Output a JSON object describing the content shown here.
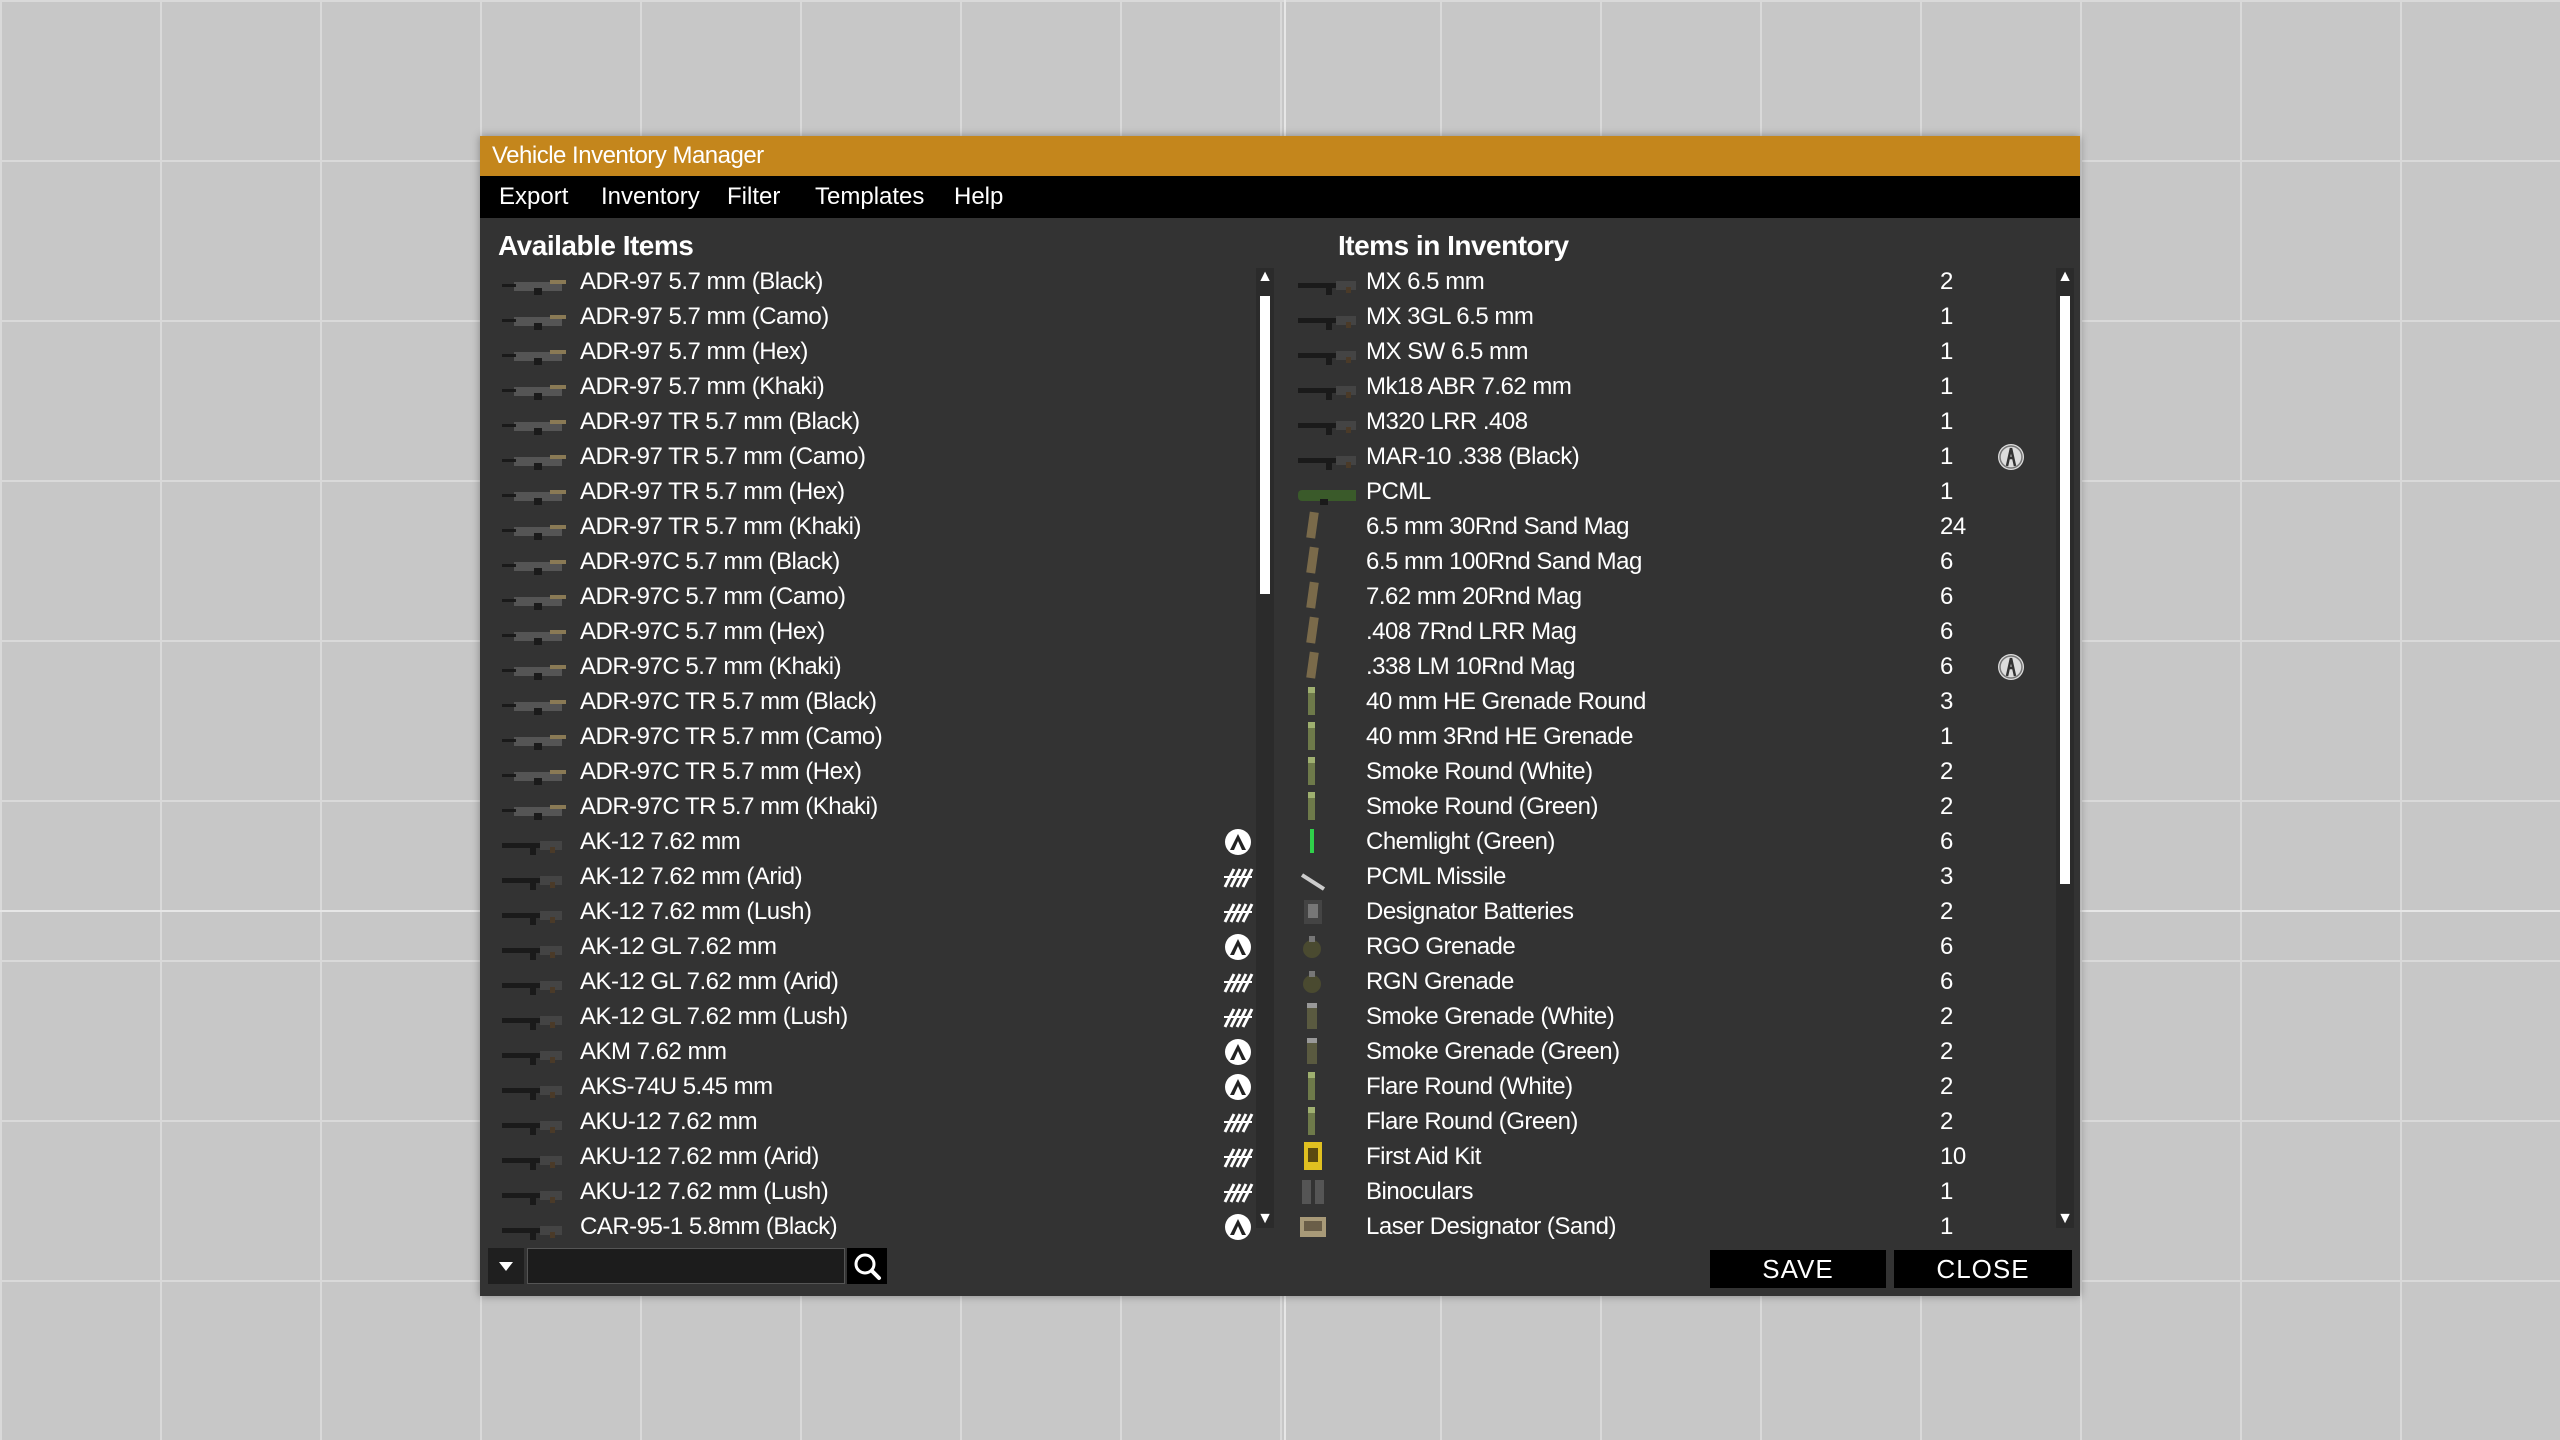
{
  "window": {
    "title": "Vehicle Inventory Manager"
  },
  "menu": {
    "export": "Export",
    "inventory": "Inventory",
    "filter": "Filter",
    "templates": "Templates",
    "help": "Help"
  },
  "available": {
    "title": "Available Items",
    "items": [
      {
        "name": "ADR-97 5.7 mm (Black)",
        "icon": "smg-icon",
        "mod": ""
      },
      {
        "name": "ADR-97 5.7 mm (Camo)",
        "icon": "smg-icon",
        "mod": ""
      },
      {
        "name": "ADR-97 5.7 mm (Hex)",
        "icon": "smg-icon",
        "mod": ""
      },
      {
        "name": "ADR-97 5.7 mm (Khaki)",
        "icon": "smg-icon",
        "mod": ""
      },
      {
        "name": "ADR-97 TR 5.7 mm (Black)",
        "icon": "smg-icon",
        "mod": ""
      },
      {
        "name": "ADR-97 TR 5.7 mm (Camo)",
        "icon": "smg-icon",
        "mod": ""
      },
      {
        "name": "ADR-97 TR 5.7 mm (Hex)",
        "icon": "smg-icon",
        "mod": ""
      },
      {
        "name": "ADR-97 TR 5.7 mm (Khaki)",
        "icon": "smg-icon",
        "mod": ""
      },
      {
        "name": "ADR-97C 5.7 mm (Black)",
        "icon": "smg-icon",
        "mod": ""
      },
      {
        "name": "ADR-97C 5.7 mm (Camo)",
        "icon": "smg-icon",
        "mod": ""
      },
      {
        "name": "ADR-97C 5.7 mm (Hex)",
        "icon": "smg-icon",
        "mod": ""
      },
      {
        "name": "ADR-97C 5.7 mm (Khaki)",
        "icon": "smg-icon",
        "mod": ""
      },
      {
        "name": "ADR-97C TR 5.7 mm (Black)",
        "icon": "smg-icon",
        "mod": ""
      },
      {
        "name": "ADR-97C TR 5.7 mm (Camo)",
        "icon": "smg-icon",
        "mod": ""
      },
      {
        "name": "ADR-97C TR 5.7 mm (Hex)",
        "icon": "smg-icon",
        "mod": ""
      },
      {
        "name": "ADR-97C TR 5.7 mm (Khaki)",
        "icon": "smg-icon",
        "mod": ""
      },
      {
        "name": "AK-12 7.62 mm",
        "icon": "rifle-icon",
        "mod": "apex-icon"
      },
      {
        "name": "AK-12 7.62 mm (Arid)",
        "icon": "rifle-icon",
        "mod": "contact-icon"
      },
      {
        "name": "AK-12 7.62 mm (Lush)",
        "icon": "rifle-icon",
        "mod": "contact-icon"
      },
      {
        "name": "AK-12 GL 7.62 mm",
        "icon": "rifle-icon",
        "mod": "apex-icon"
      },
      {
        "name": "AK-12 GL 7.62 mm (Arid)",
        "icon": "rifle-icon",
        "mod": "contact-icon"
      },
      {
        "name": "AK-12 GL 7.62 mm (Lush)",
        "icon": "rifle-icon",
        "mod": "contact-icon"
      },
      {
        "name": "AKM 7.62 mm",
        "icon": "rifle-icon",
        "mod": "apex-icon"
      },
      {
        "name": "AKS-74U 5.45 mm",
        "icon": "rifle-icon",
        "mod": "apex-icon"
      },
      {
        "name": "AKU-12 7.62 mm",
        "icon": "rifle-icon",
        "mod": "contact-icon"
      },
      {
        "name": "AKU-12 7.62 mm (Arid)",
        "icon": "rifle-icon",
        "mod": "contact-icon"
      },
      {
        "name": "AKU-12 7.62 mm (Lush)",
        "icon": "rifle-icon",
        "mod": "contact-icon"
      },
      {
        "name": "CAR-95-1 5.8mm (Black)",
        "icon": "rifle-icon",
        "mod": "apex-icon"
      }
    ]
  },
  "inventory": {
    "title": "Items in Inventory",
    "items": [
      {
        "name": "MX 6.5 mm",
        "qty": "2",
        "icon": "rifle-icon",
        "mod": ""
      },
      {
        "name": "MX 3GL 6.5 mm",
        "qty": "1",
        "icon": "rifle-icon",
        "mod": ""
      },
      {
        "name": "MX SW 6.5 mm",
        "qty": "1",
        "icon": "rifle-icon",
        "mod": ""
      },
      {
        "name": "Mk18 ABR 7.62 mm",
        "qty": "1",
        "icon": "rifle-icon",
        "mod": ""
      },
      {
        "name": "M320 LRR .408",
        "qty": "1",
        "icon": "rifle-icon",
        "mod": ""
      },
      {
        "name": "MAR-10 .338 (Black)",
        "qty": "1",
        "icon": "rifle-icon",
        "mod": "marksman-icon"
      },
      {
        "name": "PCML",
        "qty": "1",
        "icon": "launcher-icon",
        "mod": ""
      },
      {
        "name": "6.5 mm 30Rnd Sand Mag",
        "qty": "24",
        "icon": "magazine-icon",
        "mod": ""
      },
      {
        "name": "6.5 mm 100Rnd Sand Mag",
        "qty": "6",
        "icon": "magazine-icon",
        "mod": ""
      },
      {
        "name": "7.62 mm 20Rnd Mag",
        "qty": "6",
        "icon": "magazine-icon",
        "mod": ""
      },
      {
        "name": ".408 7Rnd LRR Mag",
        "qty": "6",
        "icon": "magazine-icon",
        "mod": ""
      },
      {
        "name": ".338 LM 10Rnd Mag",
        "qty": "6",
        "icon": "magazine-icon",
        "mod": "marksman-icon"
      },
      {
        "name": "40 mm HE Grenade Round",
        "qty": "3",
        "icon": "grenade-round-icon",
        "mod": ""
      },
      {
        "name": "40 mm 3Rnd HE Grenade",
        "qty": "1",
        "icon": "grenade-round-icon",
        "mod": ""
      },
      {
        "name": "Smoke Round (White)",
        "qty": "2",
        "icon": "grenade-round-icon",
        "mod": ""
      },
      {
        "name": "Smoke Round (Green)",
        "qty": "2",
        "icon": "grenade-round-icon",
        "mod": ""
      },
      {
        "name": "Chemlight (Green)",
        "qty": "6",
        "icon": "chemlight-icon",
        "mod": ""
      },
      {
        "name": "PCML Missile",
        "qty": "3",
        "icon": "missile-icon",
        "mod": ""
      },
      {
        "name": "Designator Batteries",
        "qty": "2",
        "icon": "battery-icon",
        "mod": ""
      },
      {
        "name": "RGO Grenade",
        "qty": "6",
        "icon": "hand-grenade-icon",
        "mod": ""
      },
      {
        "name": "RGN Grenade",
        "qty": "6",
        "icon": "hand-grenade-icon",
        "mod": ""
      },
      {
        "name": "Smoke Grenade (White)",
        "qty": "2",
        "icon": "smoke-grenade-icon",
        "mod": ""
      },
      {
        "name": "Smoke Grenade (Green)",
        "qty": "2",
        "icon": "smoke-grenade-icon",
        "mod": ""
      },
      {
        "name": "Flare Round (White)",
        "qty": "2",
        "icon": "grenade-round-icon",
        "mod": ""
      },
      {
        "name": "Flare Round (Green)",
        "qty": "2",
        "icon": "grenade-round-icon",
        "mod": ""
      },
      {
        "name": "First Aid Kit",
        "qty": "10",
        "icon": "first-aid-icon",
        "mod": ""
      },
      {
        "name": "Binoculars",
        "qty": "1",
        "icon": "binoculars-icon",
        "mod": ""
      },
      {
        "name": "Laser Designator (Sand)",
        "qty": "1",
        "icon": "laser-designator-icon",
        "mod": ""
      }
    ]
  },
  "scroll": {
    "left_fraction": 0.33,
    "right_fraction": 0.65
  },
  "search": {
    "placeholder": "",
    "value": ""
  },
  "buttons": {
    "save": "SAVE",
    "close": "CLOSE"
  },
  "colors": {
    "title_bar": "#c4861c",
    "panel": "#333333",
    "menu_bar": "#000000"
  }
}
